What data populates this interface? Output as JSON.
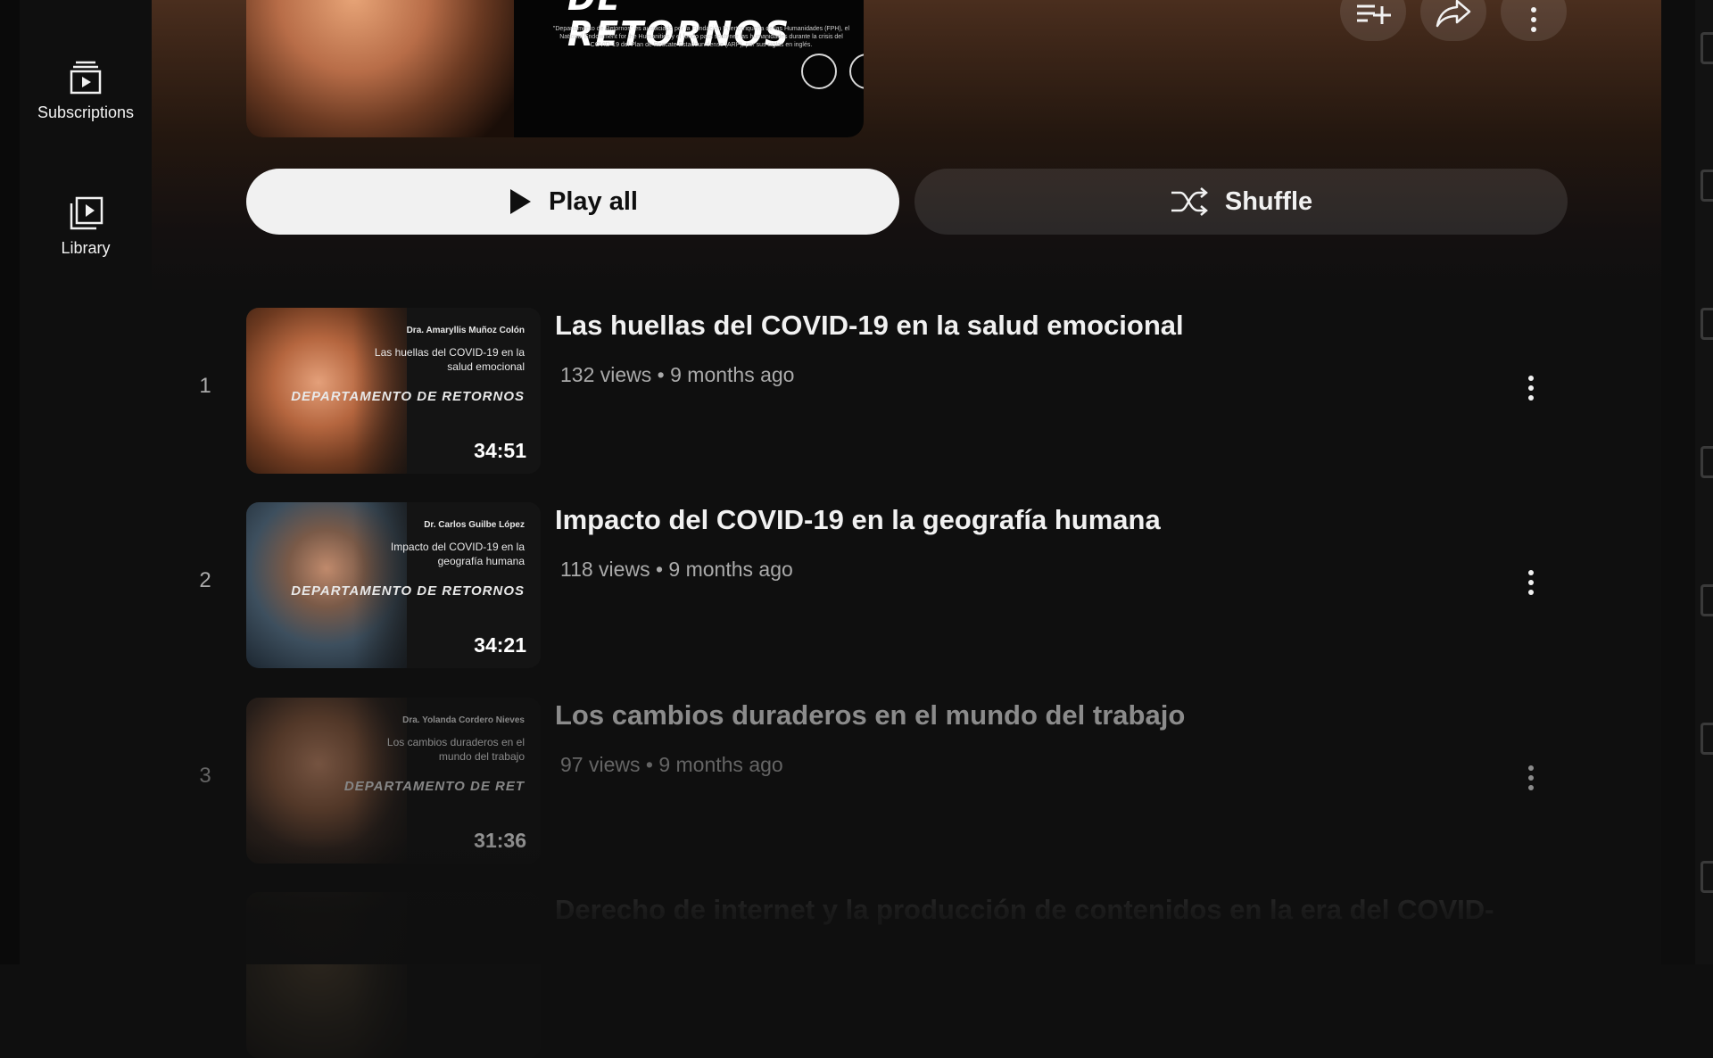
{
  "guide": {
    "subscriptions_label": "Subscriptions",
    "library_label": "Library"
  },
  "hero": {
    "brand_text": "DE RETORNOS",
    "small_print": "\"Departamento de Retornos\" es auspiciado por la Fundación Puertorriqueña de las Humanidades (FPH), el National Endowment for the Humanities y el fondo para sostener las humanidades durante la crisis del COVID-19 del Plan de Rescate Estadounidense (ARP), por sus siglas en inglés."
  },
  "actions": {
    "play_all_label": "Play all",
    "shuffle_label": "Shuffle"
  },
  "videos": [
    {
      "index": "1",
      "title": "Las huellas del COVID-19 en la salud emocional",
      "meta": "132 views • 9 months ago",
      "duration": "34:51",
      "thumb_speaker": "Dra. Amaryllis Muñoz Colón",
      "thumb_title": "Las huellas del COVID-19 en la salud emocional",
      "thumb_logo": "DEPARTAMENTO DE RETORNOS"
    },
    {
      "index": "2",
      "title": "Impacto del COVID-19 en la geografía humana",
      "meta": "118 views • 9 months ago",
      "duration": "34:21",
      "thumb_speaker": "Dr. Carlos Guilbe López",
      "thumb_title": "Impacto del COVID-19 en la geografía humana",
      "thumb_logo": "DEPARTAMENTO DE RETORNOS"
    },
    {
      "index": "3",
      "title": "Los cambios duraderos en el mundo del trabajo",
      "meta": "97 views • 9 months ago",
      "duration": "31:36",
      "thumb_speaker": "Dra. Yolanda Cordero Nieves",
      "thumb_title": "Los cambios duraderos en el mundo del trabajo",
      "thumb_logo": "DEPARTAMENTO DE RET"
    },
    {
      "index": "",
      "title": "Derecho de internet y la producción de contenidos en la era del COVID-",
      "meta": "",
      "duration": "",
      "thumb_speaker": "",
      "thumb_title": "",
      "thumb_logo": ""
    }
  ],
  "colors": {
    "background": "#0f0f0f",
    "header_gradient_top": "#4a2e1e",
    "primary_text": "#f1f1f1",
    "secondary_text": "#aaaaaa",
    "play_all_bg": "#f1f1f1"
  },
  "icons": {
    "subscriptions": "subscriptions-icon",
    "library": "library-icon",
    "save": "playlist-add-icon",
    "share": "share-icon",
    "more": "more-vert-icon",
    "play": "play-icon",
    "shuffle": "shuffle-icon"
  }
}
